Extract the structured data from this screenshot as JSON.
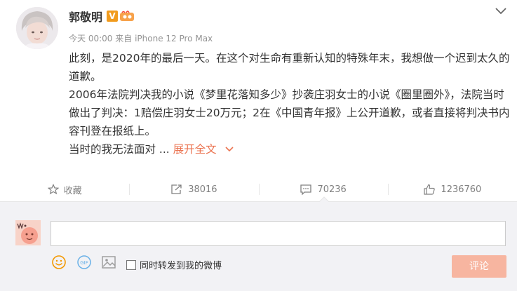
{
  "post": {
    "author": "郭敬明",
    "meta": {
      "time": "今天 00:00",
      "source_prefix": "来自",
      "device": "iPhone 12 Pro Max"
    },
    "paragraphs": [
      "此刻，是2020年的最后一天。在这个对生命有重新认知的特殊年末，我想做一个迟到太久的道歉。",
      "2006年法院判决我的小说《梦里花落知多少》抄袭庄羽女士的小说《圈里圈外》，法院当时做出了判决：1赔偿庄羽女士20万元；2在《中国青年报》上公开道歉，或者直接将判决书内容刊登在报纸上。"
    ],
    "truncated_text": "当时的我无法面对 ...",
    "expand_label": "展开全文"
  },
  "actions": {
    "favorite_label": "收藏",
    "repost_count": "38016",
    "comment_count": "70236",
    "like_count": "1236760"
  },
  "comment_box": {
    "input_value": "",
    "repost_label": "同时转发到我的微博",
    "submit_label": "评论",
    "gif_label": "GIF"
  },
  "icons": {
    "vip_badge": "V",
    "chevron": "chevron-down-icon",
    "favorite": "star-icon",
    "repost": "repost-icon",
    "comment": "comment-icon",
    "like": "thumbs-up-icon",
    "emoji": "smiley-icon",
    "gif": "gif-icon",
    "image": "image-icon"
  },
  "colors": {
    "accent": "#eb7350",
    "vip": "#f19b1d",
    "submit_disabled": "#f7b5a0",
    "meta_text": "#939393"
  }
}
